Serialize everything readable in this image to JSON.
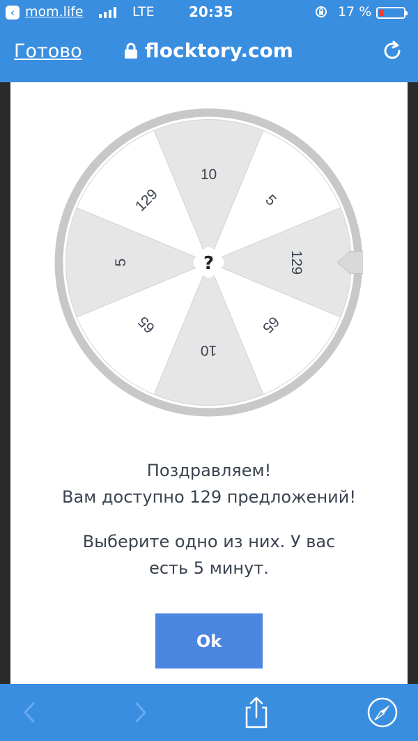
{
  "status_bar": {
    "back_app": "mom.life",
    "network": "LTE",
    "time": "20:35",
    "battery": "17 %",
    "battery_level": 0.17
  },
  "nav_bar": {
    "done_label": "Готово",
    "url": "flocktory.com",
    "icons": [
      "lock-icon",
      "reload-icon"
    ]
  },
  "wheel": {
    "segments": [
      "10",
      "5",
      "129",
      "65",
      "10",
      "65",
      "5",
      "129"
    ],
    "center": "?",
    "colors": {
      "light_segment": "#e6e6e6",
      "dark_segment": "#ffffff",
      "rim": "#c8c8c8",
      "pointer": "#d9d9d9"
    }
  },
  "message": {
    "line1": "Поздравляем!",
    "line2": "Вам доступно 129 предложений!",
    "line3": "Выберите одно из них. У вас",
    "line4": "есть 5 минут."
  },
  "ok_button": "Ok",
  "toolbar": {
    "icons": [
      "back-arrow-icon",
      "forward-arrow-icon",
      "share-icon",
      "compass-icon"
    ]
  },
  "colors": {
    "accent": "#3a8ee0",
    "button": "#4b86e0",
    "text": "#3a4350"
  }
}
